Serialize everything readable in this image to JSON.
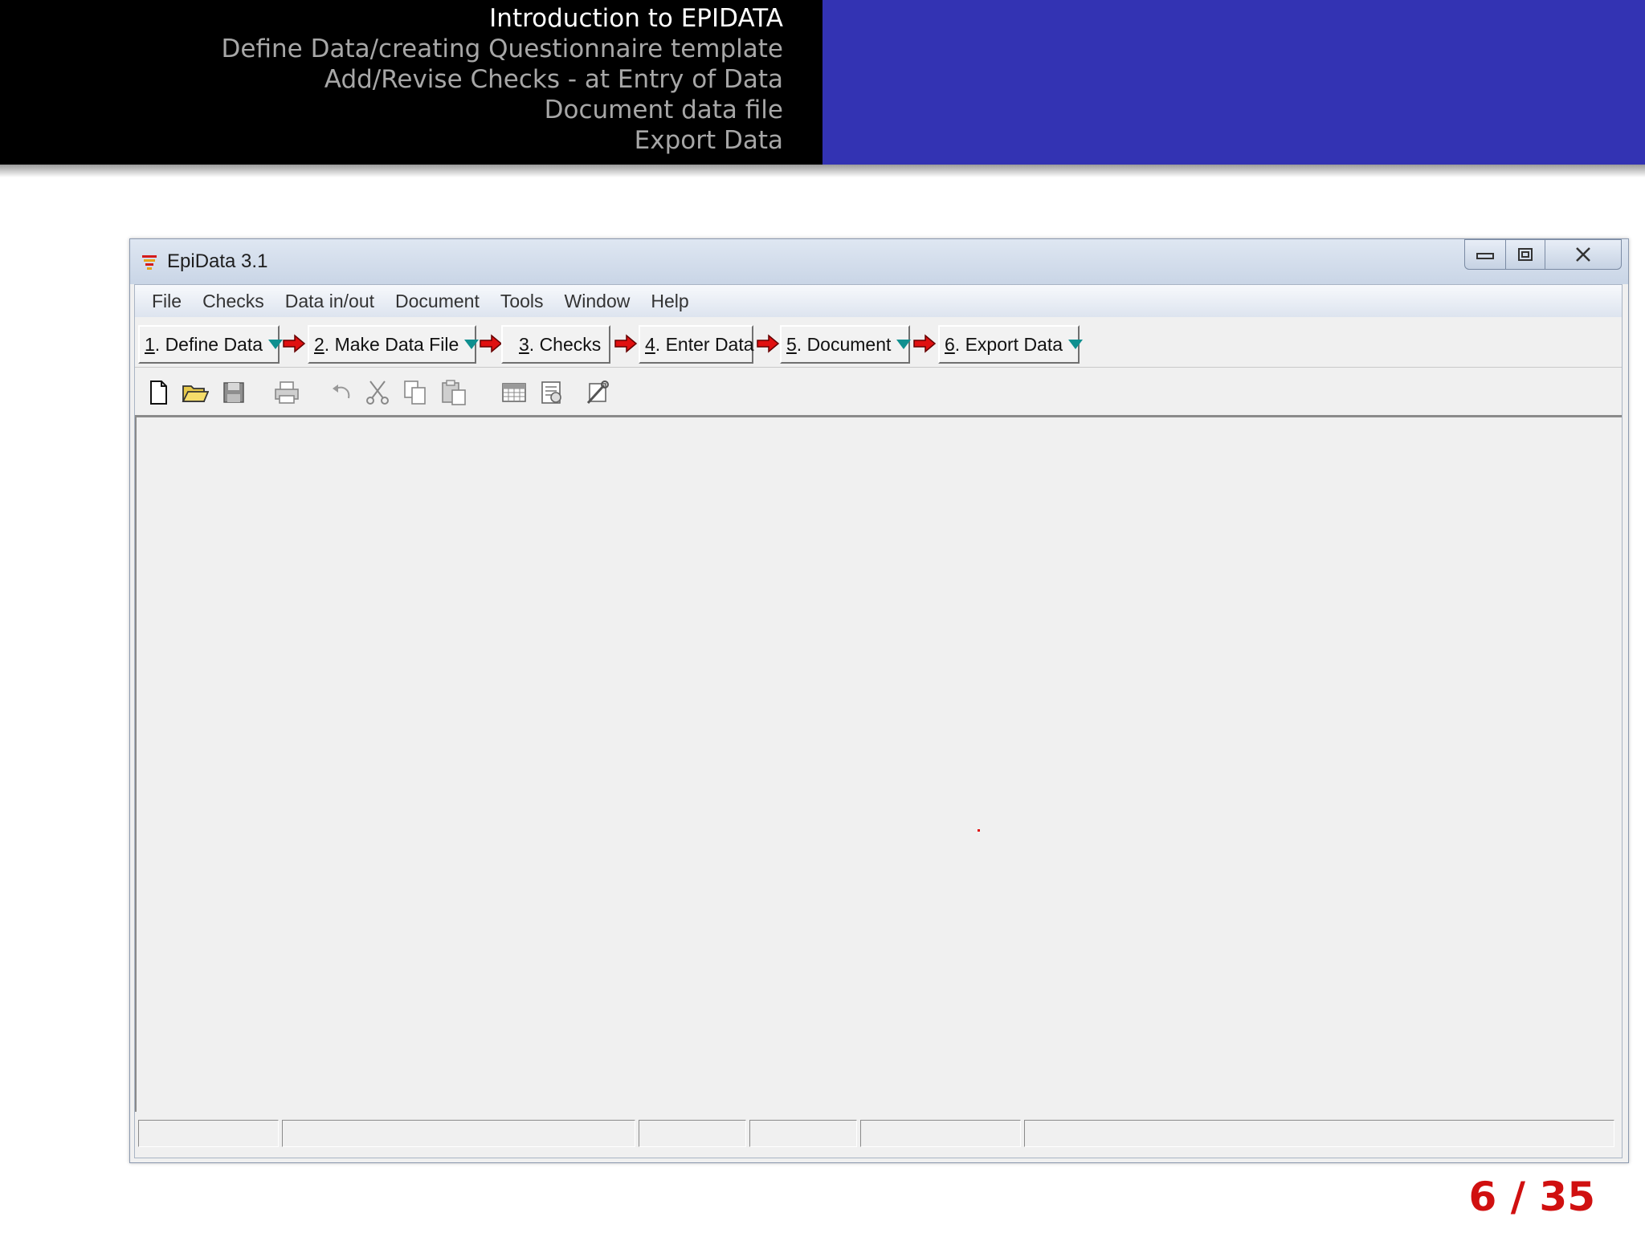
{
  "slide": {
    "nav": [
      "Introduction to EPIDATA",
      "Define Data/creating Questionnaire template",
      "Add/Revise Checks - at Entry of Data",
      "Document data file",
      "Export Data"
    ],
    "active_nav_index": 0,
    "page_number": "6 / 35"
  },
  "window": {
    "title": "EpiData 3.1",
    "menu": [
      "File",
      "Checks",
      "Data in/out",
      "Document",
      "Tools",
      "Window",
      "Help"
    ],
    "workflow_buttons": [
      {
        "num": "1",
        "label": ". Define Data",
        "dropdown": true
      },
      {
        "num": "2",
        "label": ". Make Data File",
        "dropdown": true
      },
      {
        "num": "3",
        "label": ". Checks",
        "dropdown": false
      },
      {
        "num": "4",
        "label": ". Enter Data",
        "dropdown": false
      },
      {
        "num": "5",
        "label": ". Document",
        "dropdown": true
      },
      {
        "num": "6",
        "label": ". Export Data",
        "dropdown": true
      }
    ],
    "toolbar_icons": [
      "new-file-icon",
      "open-folder-icon",
      "save-icon",
      "print-icon",
      "undo-icon",
      "cut-icon",
      "copy-icon",
      "paste-icon",
      "table-icon",
      "codebook-icon",
      "tools-icon"
    ],
    "status_cells": [
      "",
      "",
      "",
      "",
      "",
      ""
    ]
  },
  "colors": {
    "header_left": "#000000",
    "header_right": "#3333b3",
    "nav_active": "#ffffff",
    "nav_inactive": "#a7a7a7",
    "page_number": "#d01010",
    "workflow_arrow": "#e01010",
    "dropdown_triangle": "#0f8f8f"
  }
}
